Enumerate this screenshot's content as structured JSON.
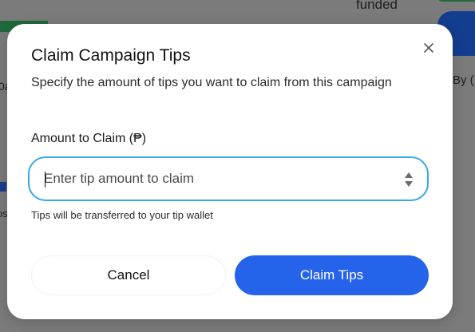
{
  "background": {
    "funded_text": "funded",
    "by_text": "By (",
    "left_text_1": "0a",
    "left_text_2": "os"
  },
  "modal": {
    "title": "Claim Campaign Tips",
    "subtitle": "Specify the amount of tips you want to claim from this campaign",
    "close_icon": "close-icon",
    "field": {
      "label": "Amount to Claim (₱)",
      "placeholder": "Enter tip amount to claim",
      "value": "",
      "stepper_icon": "stepper-icon"
    },
    "helper_text": "Tips will be transferred to your tip wallet",
    "buttons": {
      "cancel_label": "Cancel",
      "claim_label": "Claim Tips"
    }
  },
  "colors": {
    "primary": "#2563eb",
    "focus_border": "#38a9e8",
    "overlay": "#7b7b7b"
  }
}
